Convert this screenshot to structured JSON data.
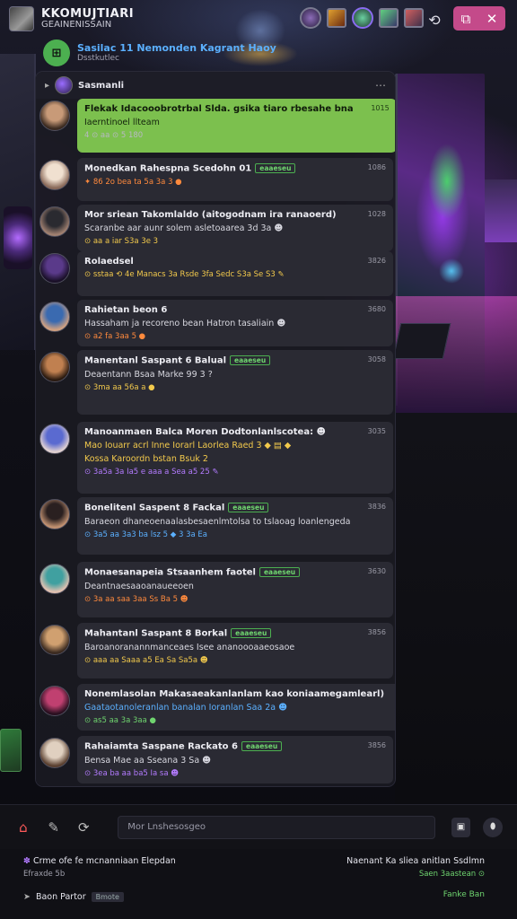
{
  "header": {
    "title": "KKOMUJTIARI",
    "subtitle": "GEAINENISSAIN",
    "sync_icon": "sync-icon",
    "window_buttons": [
      "⧉",
      "✕"
    ]
  },
  "channel": {
    "icon_label": "⊞",
    "title": "Sasilac 11 Nemonden Kagrant Haoy",
    "subtitle": "Dsstkutlec"
  },
  "panel": {
    "name": "Sasmanli",
    "back": "▸"
  },
  "messages": [
    {
      "line1": "Flekak Idacooobrotrbal Slda. gsika tiaro rbesahe bna",
      "line2": "Iaerntinoel llteam",
      "meta": "4 ⊙ aa ⊙ 5 180",
      "time": "1015",
      "green": true
    },
    {
      "line1": "Monedkan Rahespna Scedohn 01",
      "tag": "eaaeseu",
      "line2": "",
      "meta": "✦ 86 2o bea ta  5a 3a 3 ●",
      "time": "1086"
    },
    {
      "line1": "Mor sriean Takomlaldo (aitogodnam ira ranaoerd)",
      "line2": "Scaranbe aar aunr solem asletoaarea 3d 3a ☻",
      "meta": "⊙ aa a iar  S3a 3e 3",
      "time": "1028"
    },
    {
      "line1": "Rolaedsel",
      "line2": "",
      "meta": "⊙ sstaa ⟲ 4e Manacs 3a Rsde 3fa Sedc S3a Se S3 ✎",
      "time": "3826"
    },
    {
      "line1": "Rahietan beon 6",
      "line2": "Hassaham ja recoreno bean Hatron tasaliain ☻",
      "meta": "⊙ a2 fa 3aa 5 ●",
      "time": "3680"
    },
    {
      "line1": "Manentanl Saspant 6 Balual",
      "tag": "eaaeseu",
      "line2": "Deaentann Bsaa Marke 99 3 ?",
      "meta": "⊙ 3ma aa 56a a ●",
      "time": "3058"
    },
    {
      "line1": "Manoanmaen Balca Moren Dodtonlanlscotea: ☻",
      "line2": "Mao Iouarr acrl  Inne Iorarl  Laorlea Raed 3 ◆ ▤ ◆",
      "line3": "Kossa Karoordn bstan Bsuk 2",
      "meta": "⊙ 3a5a 3a Ia5 e  aaa a  Sea a5 25 ✎",
      "time": "3035"
    },
    {
      "line1": "Bonelitenl Saspent 8 Fackal",
      "tag": "eaaeseu",
      "line2": "Baraeon dhaneoenaalasbesaenlmtolsa to tslaoag loanlengeda",
      "meta": "⊙ 3a5 aa 3a3 ba lsz 5 ◆ 3 3a Ea",
      "time": "3836"
    },
    {
      "line1": "Monaesanapeia Stsaanhem faotel",
      "tag": "eaaeseu",
      "line2": "Deantnaesaaoanaueeoen",
      "meta": "⊙ 3a aa saa 3aa Ss Ba 5 ☻",
      "time": "3630"
    },
    {
      "line1": "Mahantanl Saspant 8 Borkal",
      "tag": "eaaeseu",
      "line2": "Baroanoranannmanceaes Isee ananoooaaeosaoe",
      "meta": "⊙ aaa aa  Saaa a5  Ea Sa  Sa5a ☻",
      "time": "3856"
    },
    {
      "line1": "Nonemlasolan Makasaeakanlanlam kao koniaamegamlearl)",
      "line2": "Gaataotanoleranlan banalan Ioranlan Saa 2a ☻",
      "meta": "⊙ as5 aa 3a 3aa ●",
      "time": "3826"
    },
    {
      "line1": "Rahaiamta Saspane Rackato 6",
      "tag": "eaaeseu",
      "line2": "Bensa Mae aa Sseana 3 Sa ☻",
      "meta": "⊙ 3ea ba aa  ba5 Ia  sa ☻",
      "time": "3856"
    }
  ],
  "composer": {
    "placeholder": "Mor Lnshesosgeo",
    "send_label": "▣",
    "mic_label": "⬮"
  },
  "footer": {
    "left1": "Crme ofe fe  mcnanniaan Elepdan",
    "left1_sub": "Efraxde 5b",
    "right1": "Naenant Ka sliea  anitlan Ssdlmn",
    "right1_sub": "Saen 3aastean ⊙",
    "left2": "Baon Partor",
    "left2_badge": "Bmote",
    "right2": "Fanke Ban"
  },
  "colors": {
    "accent": "#7cc04e",
    "pink": "#c44a8a",
    "blue": "#5bb0ff"
  }
}
